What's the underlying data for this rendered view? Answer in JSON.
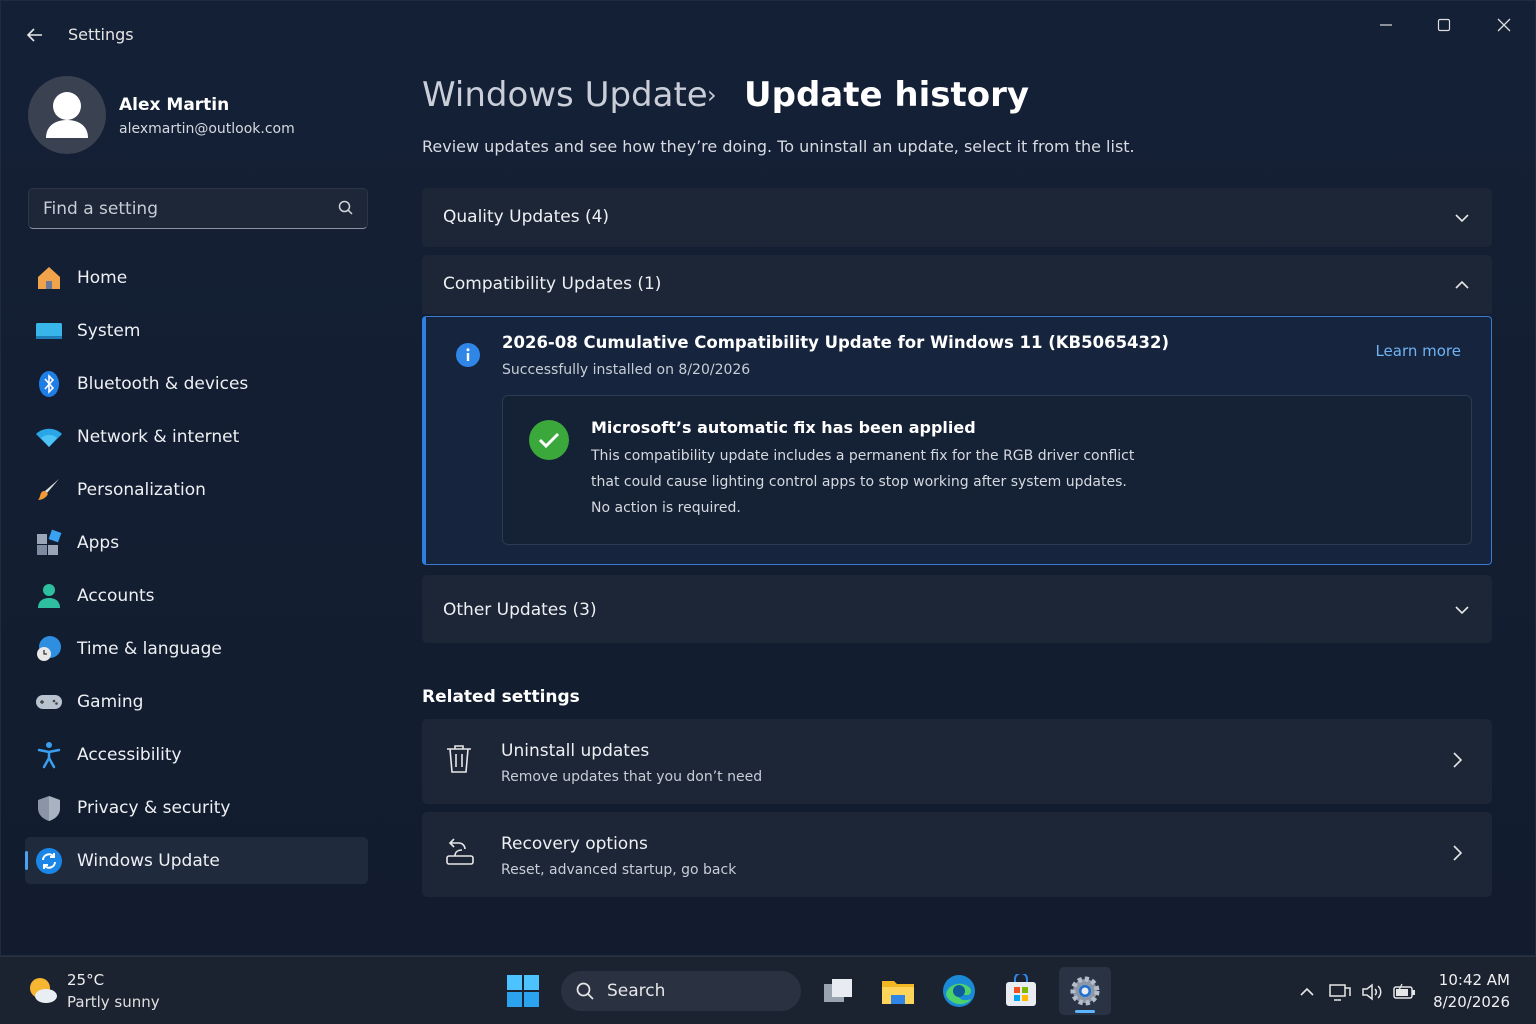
{
  "window": {
    "title": "Settings"
  },
  "profile": {
    "name": "Alex Martin",
    "email": "alexmartin@outlook.com"
  },
  "search": {
    "placeholder": "Find a setting"
  },
  "sidebar": {
    "items": [
      {
        "label": "Home",
        "icon": "home-icon"
      },
      {
        "label": "System",
        "icon": "monitor-icon"
      },
      {
        "label": "Bluetooth & devices",
        "icon": "bluetooth-icon"
      },
      {
        "label": "Network & internet",
        "icon": "wifi-icon"
      },
      {
        "label": "Personalization",
        "icon": "brush-icon"
      },
      {
        "label": "Apps",
        "icon": "apps-icon"
      },
      {
        "label": "Accounts",
        "icon": "person-icon"
      },
      {
        "label": "Time & language",
        "icon": "globe-clock-icon"
      },
      {
        "label": "Gaming",
        "icon": "gamepad-icon"
      },
      {
        "label": "Accessibility",
        "icon": "accessibility-icon"
      },
      {
        "label": "Privacy & security",
        "icon": "shield-icon"
      },
      {
        "label": "Windows Update",
        "icon": "sync-icon",
        "active": true
      }
    ]
  },
  "breadcrumb": {
    "parent": "Windows Update",
    "separator": "›",
    "current": "Update history"
  },
  "page": {
    "description": "Review updates and see how they’re doing. To uninstall an update, select it from the list."
  },
  "sections": {
    "quality": {
      "label": "Quality Updates (4)",
      "expanded": false
    },
    "compatibility": {
      "label": "Compatibility Updates (1)",
      "expanded": true
    },
    "other": {
      "label": "Other Updates (3)",
      "expanded": false
    }
  },
  "update": {
    "title": "2026-08 Cumulative Compatibility Update for Windows 11 (KB5065432)",
    "status": "Successfully installed on 8/20/2026",
    "learn_more": "Learn more",
    "fix_title": "Microsoft’s automatic fix has been applied",
    "fix_line1": "This compatibility update includes a permanent fix for the RGB driver conflict",
    "fix_line2": "that could cause lighting control  apps to stop working after system updates.",
    "fix_line3": "No action is required."
  },
  "related": {
    "title": "Related settings",
    "uninstall": {
      "title": "Uninstall updates",
      "subtitle": "Remove updates that you don’t need"
    },
    "recovery": {
      "title": "Recovery options",
      "subtitle": "Reset, advanced startup, go back"
    }
  },
  "taskbar": {
    "weather_temp": "25°C",
    "weather_desc": "Partly sunny",
    "search_label": "Search",
    "time": "10:42 AM",
    "date": "8/20/2026"
  },
  "colors": {
    "accent": "#4aa3f0",
    "link": "#6fb3f5",
    "success": "#3aa83a",
    "info": "#2f86e6"
  }
}
